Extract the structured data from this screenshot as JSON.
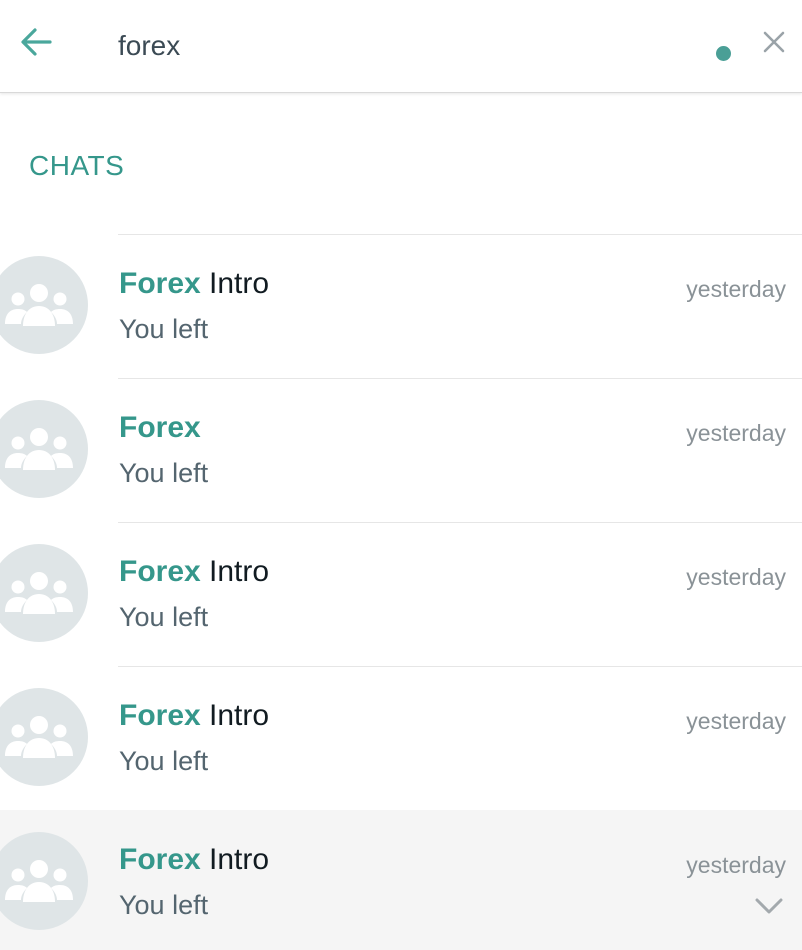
{
  "search": {
    "value": "forex",
    "placeholder": ""
  },
  "icons": {
    "back": "back-arrow-icon",
    "clear": "close-icon",
    "avatar": "group-icon",
    "row_menu": "chevron-down-icon"
  },
  "colors": {
    "accent": "#35978b",
    "avatar_bg": "#dfe5e7",
    "active_row_bg": "#f5f5f5"
  },
  "section": {
    "title": "CHATS"
  },
  "chats": [
    {
      "match": "Forex",
      "rest": " Intro",
      "time": "yesterday",
      "preview": "You left"
    },
    {
      "match": "Forex",
      "rest": "",
      "time": "yesterday",
      "preview": "You left"
    },
    {
      "match": "Forex",
      "rest": " Intro",
      "time": "yesterday",
      "preview": "You left"
    },
    {
      "match": "Forex",
      "rest": " Intro",
      "time": "yesterday",
      "preview": "You left"
    },
    {
      "match": "Forex",
      "rest": " Intro",
      "time": "yesterday",
      "preview": "You left"
    }
  ]
}
